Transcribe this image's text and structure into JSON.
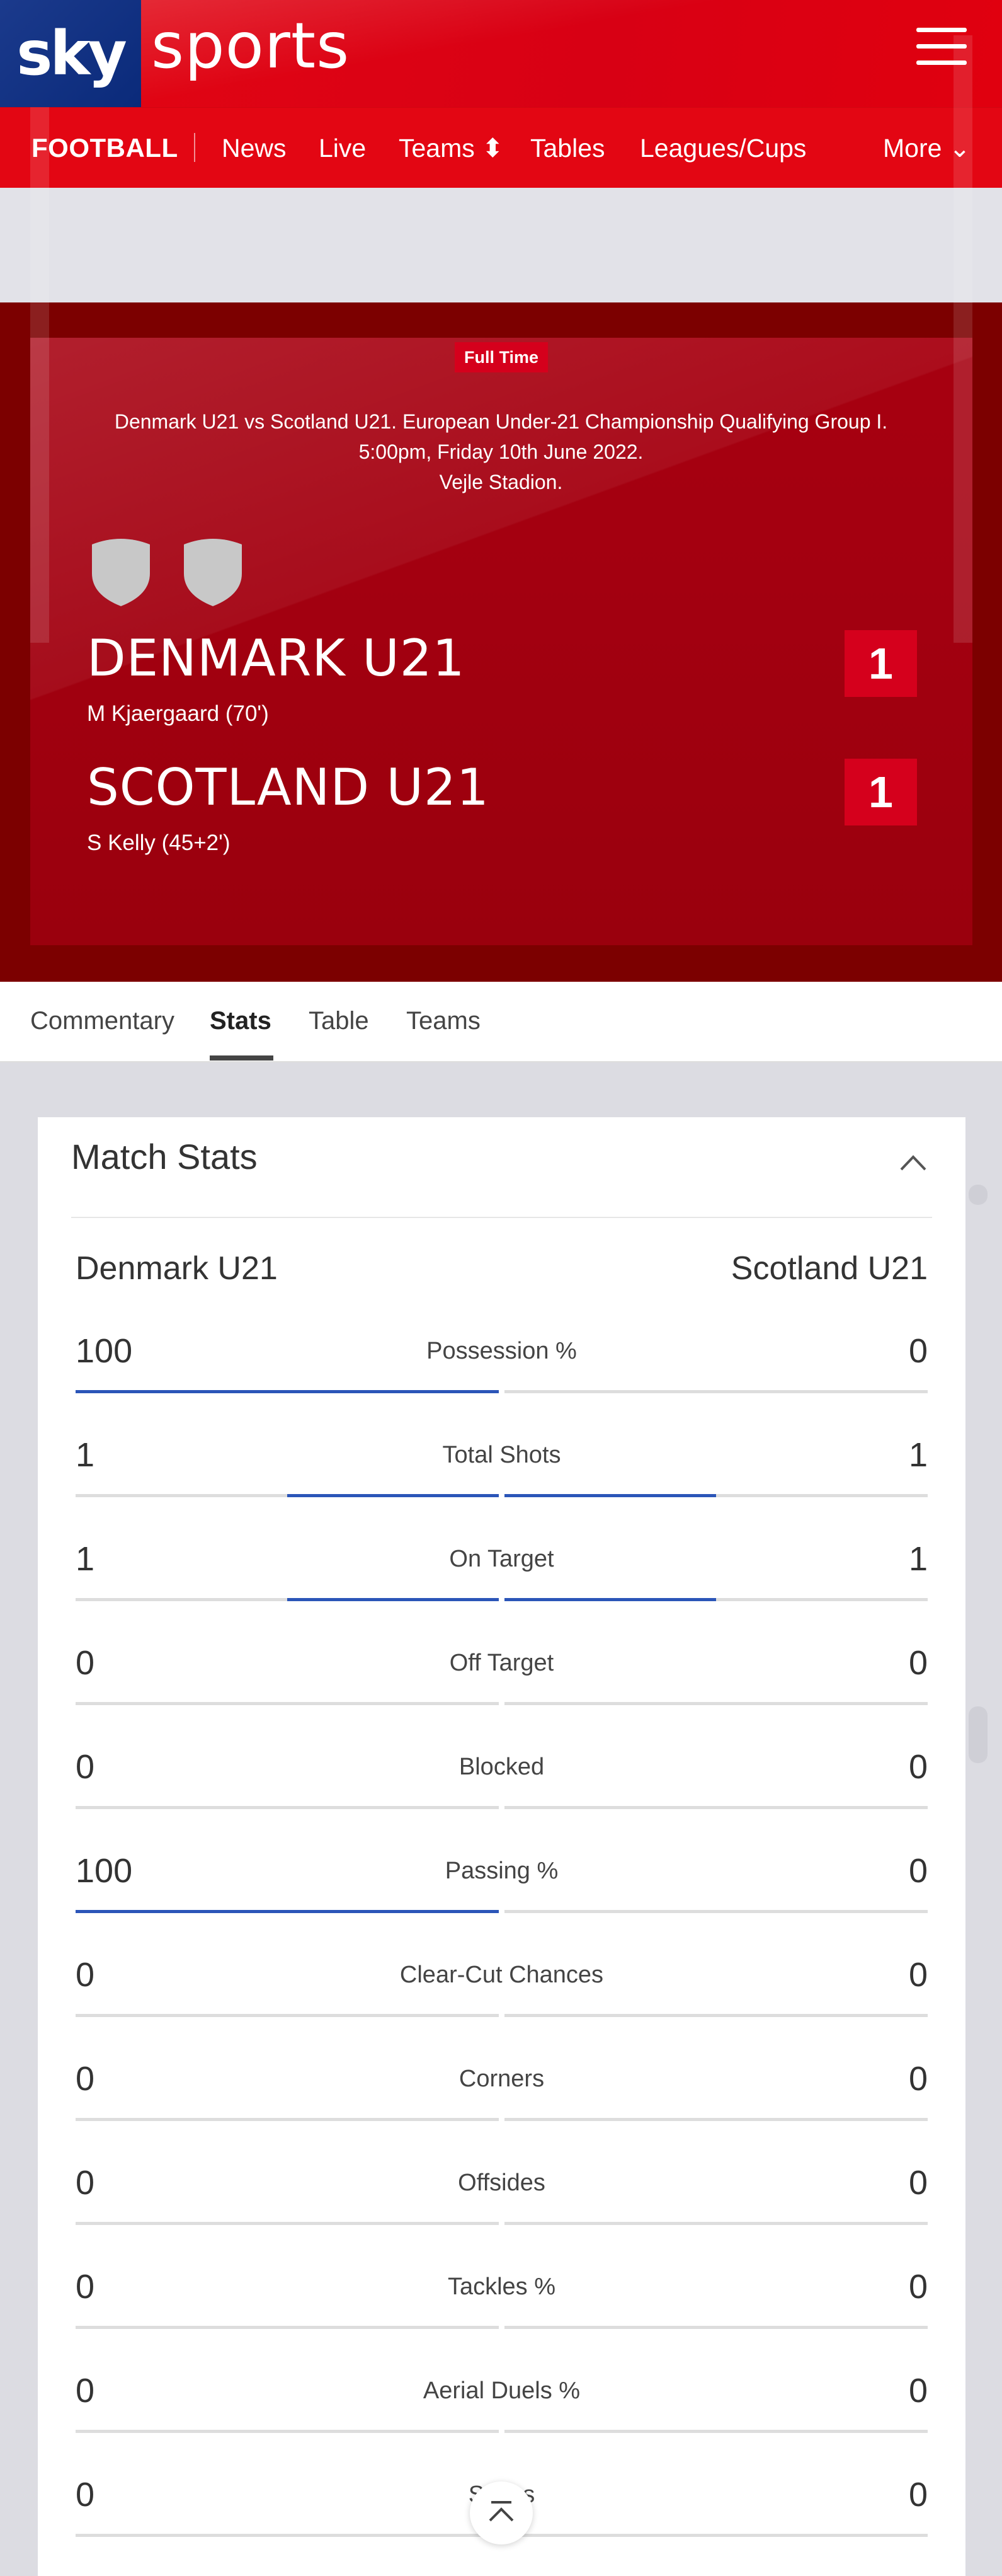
{
  "header": {
    "logo_sky": "sky",
    "logo_sports": "sports"
  },
  "nav": {
    "section": "FOOTBALL",
    "items": [
      {
        "label": "News"
      },
      {
        "label": "Live"
      },
      {
        "label": "Teams ⬍"
      },
      {
        "label": "Tables"
      },
      {
        "label": "Leagues/Cups"
      },
      {
        "label": "More ⌄"
      }
    ]
  },
  "match": {
    "status": "Full Time",
    "info_line1": "Denmark U21 vs Scotland U21. European Under-21 Championship Qualifying Group I.",
    "info_line2": "5:00pm, Friday 10th June 2022.",
    "info_line3": "Vejle Stadion.",
    "home": {
      "name": "DENMARK U21",
      "scorers": "M Kjaergaard (70')",
      "score": "1"
    },
    "away": {
      "name": "SCOTLAND U21",
      "scorers": "S Kelly (45+2')",
      "score": "1"
    }
  },
  "tabs": [
    {
      "label": "Commentary"
    },
    {
      "label": "Stats"
    },
    {
      "label": "Table"
    },
    {
      "label": "Teams"
    }
  ],
  "stats": {
    "title": "Match Stats",
    "home_team": "Denmark U21",
    "away_team": "Scotland U21",
    "rows": [
      {
        "label": "Possession %",
        "home": "100",
        "away": "0",
        "home_frac": 1.0,
        "away_frac": 0.0
      },
      {
        "label": "Total Shots",
        "home": "1",
        "away": "1",
        "home_frac": 0.5,
        "away_frac": 0.5
      },
      {
        "label": "On Target",
        "home": "1",
        "away": "1",
        "home_frac": 0.5,
        "away_frac": 0.5
      },
      {
        "label": "Off Target",
        "home": "0",
        "away": "0",
        "home_frac": 0.0,
        "away_frac": 0.0
      },
      {
        "label": "Blocked",
        "home": "0",
        "away": "0",
        "home_frac": 0.0,
        "away_frac": 0.0
      },
      {
        "label": "Passing %",
        "home": "100",
        "away": "0",
        "home_frac": 1.0,
        "away_frac": 0.0
      },
      {
        "label": "Clear-Cut Chances",
        "home": "0",
        "away": "0",
        "home_frac": 0.0,
        "away_frac": 0.0
      },
      {
        "label": "Corners",
        "home": "0",
        "away": "0",
        "home_frac": 0.0,
        "away_frac": 0.0
      },
      {
        "label": "Offsides",
        "home": "0",
        "away": "0",
        "home_frac": 0.0,
        "away_frac": 0.0
      },
      {
        "label": "Tackles %",
        "home": "0",
        "away": "0",
        "home_frac": 0.0,
        "away_frac": 0.0
      },
      {
        "label": "Aerial Duels %",
        "home": "0",
        "away": "0",
        "home_frac": 0.0,
        "away_frac": 0.0
      },
      {
        "label": "Saves",
        "home": "0",
        "away": "0",
        "home_frac": 0.0,
        "away_frac": 0.0
      }
    ]
  },
  "colors": {
    "brand_red": "#e30613",
    "bar_blue": "#2b55b8",
    "score_red": "#d5001c"
  }
}
